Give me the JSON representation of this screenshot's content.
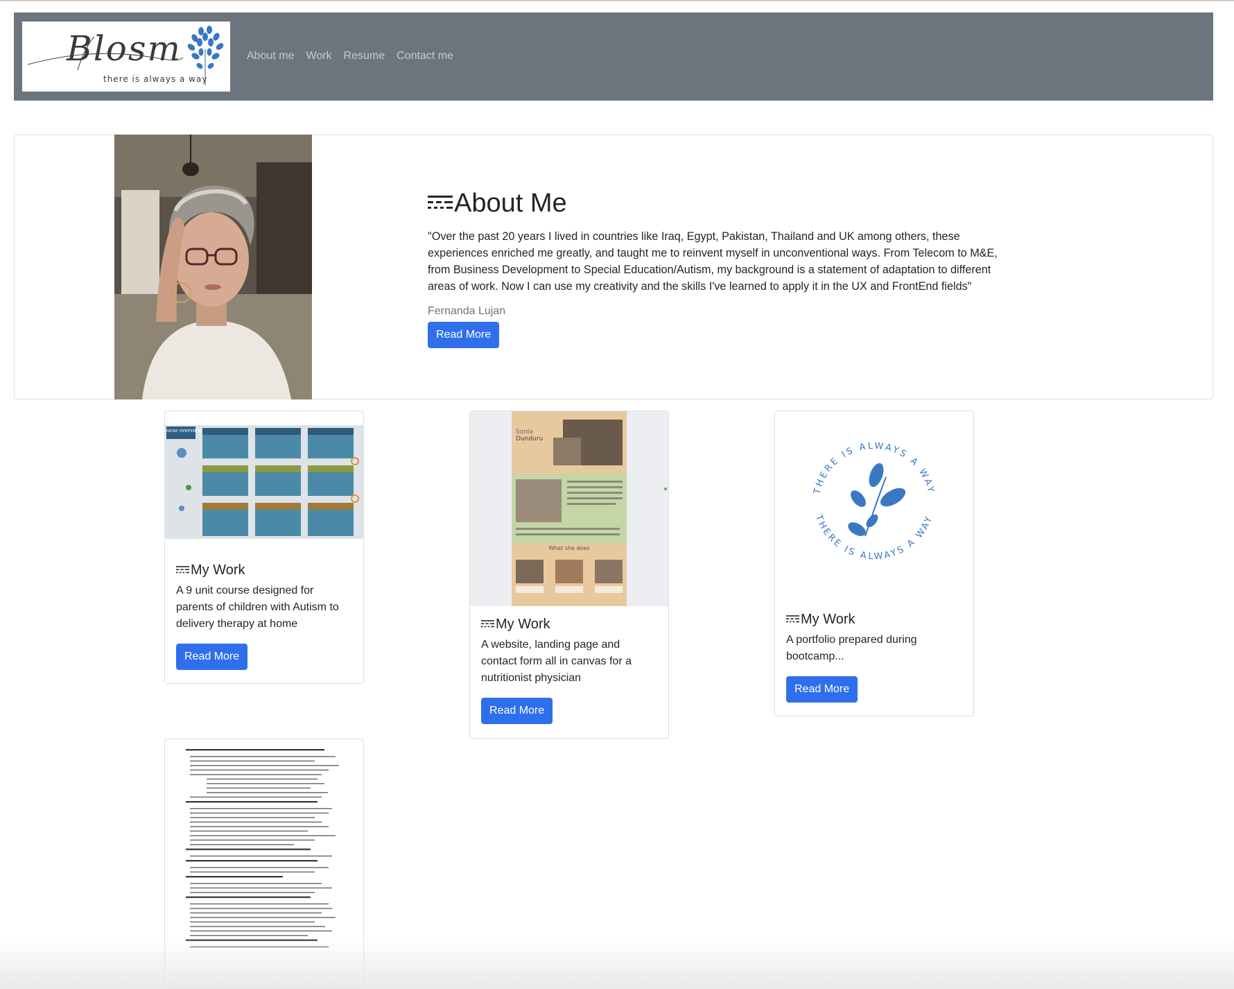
{
  "brand": {
    "name": "Blosm",
    "tagline": "there is always a way",
    "logo_icon": "tree-icon"
  },
  "nav": {
    "items": [
      {
        "label": "About me"
      },
      {
        "label": "Work"
      },
      {
        "label": "Resume"
      },
      {
        "label": "Contact me"
      }
    ]
  },
  "about": {
    "title_icon": "lines-icon",
    "title": "About Me",
    "text": "\"Over the past 20 years I lived in countries like Iraq, Egypt, Pakistan, Thailand and UK among others, these experiences enriched me greatly, and taught me to reinvent myself in unconventional ways. From Telecom to M&E, from Business Development to Special Education/Autism, my background is a statement of adaptation to different areas of work. Now I can use my creativity and the skills I've learned to apply it in the UX and FrontEnd fields\"",
    "author": "Fernanda Lujan",
    "button": "Read More"
  },
  "work": [
    {
      "title": "My Work",
      "text": "A 9 unit course designed for parents of children with Autism to delivery therapy at home",
      "button": "Read More",
      "thumbnail_text": "Course overview"
    },
    {
      "title": "My Work",
      "text": "A website, landing page and contact form all in canvas for a nutritionist physician",
      "button": "Read More",
      "thumbnail_text": [
        "Sonia",
        "Dunduru",
        "What she does"
      ]
    },
    {
      "title": "My Work",
      "text": "A portfolio prepared during bootcamp...",
      "button": "Read More",
      "thumbnail_text": [
        "THERE IS ALWAYS A WAY",
        "THERE IS ALWAYS A WAY"
      ]
    }
  ],
  "colors": {
    "navbar": "#6c757d",
    "button": "#2f6fec",
    "accent_blue": "#3a78c2"
  }
}
